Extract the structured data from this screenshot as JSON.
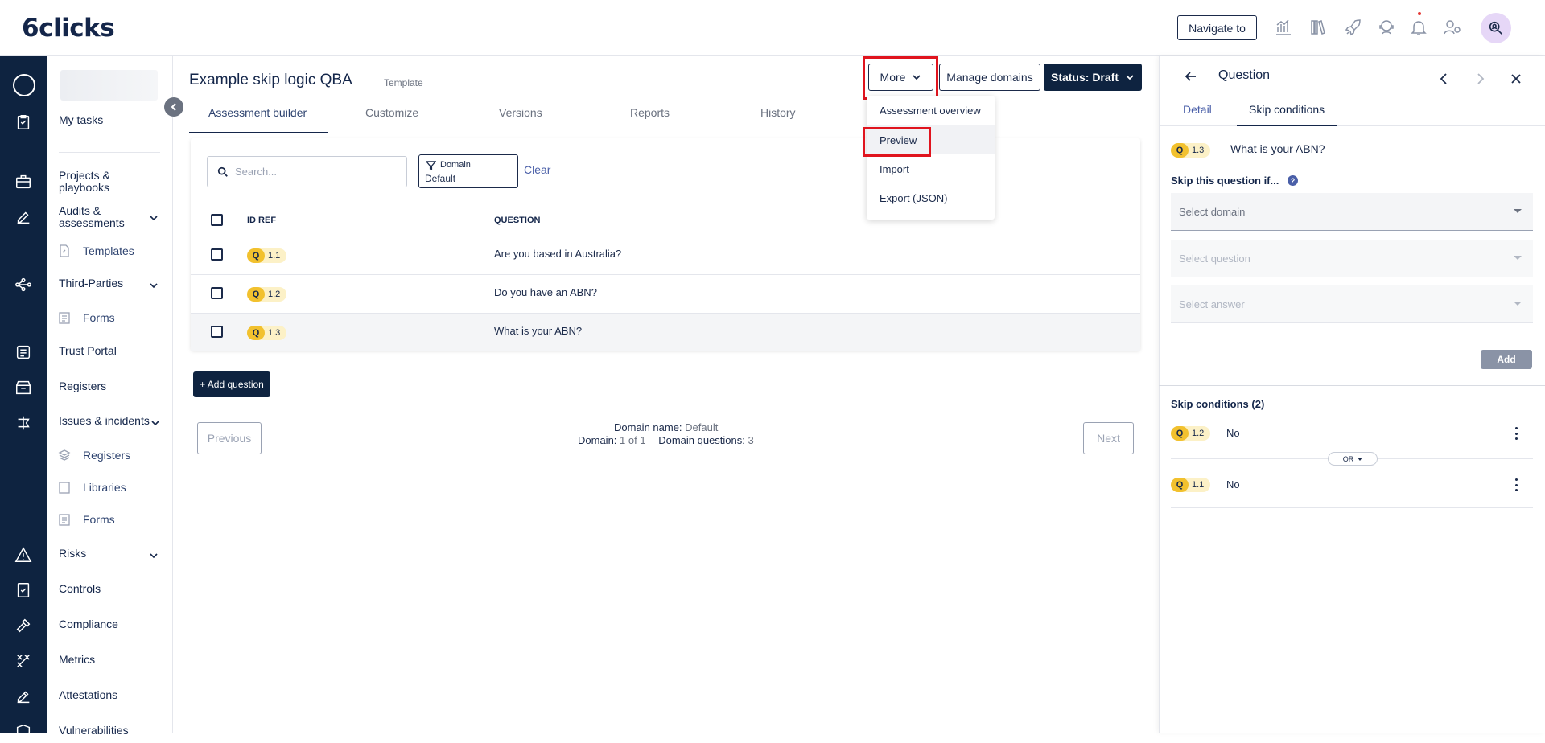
{
  "header": {
    "logo": "6clicks",
    "navigate_to": "Navigate to",
    "icons": [
      "analytics-icon",
      "library-icon",
      "rocket-icon",
      "support-icon",
      "bell-icon",
      "user-settings-icon"
    ],
    "avatar_icon": "search-user-icon"
  },
  "rail": {
    "icons": [
      "tasks-icon",
      "briefcase-icon",
      "edit-icon",
      "network-icon",
      "forms-icon",
      "registers-icon",
      "incident-icon",
      "risk-warning-icon",
      "controls-icon",
      "compliance-gavel-icon",
      "metrics-tools-icon",
      "attestations-icon",
      "vulnerabilities-shield-icon"
    ]
  },
  "sidenav": {
    "my_tasks": "My tasks",
    "projects": "Projects & playbooks",
    "audits": "Audits & assessments",
    "templates": "Templates",
    "third_parties": "Third-Parties",
    "forms1": "Forms",
    "trust_portal": "Trust Portal",
    "registers": "Registers",
    "issues": "Issues & incidents",
    "registers_sub": "Registers",
    "libraries": "Libraries",
    "forms2": "Forms",
    "risks": "Risks",
    "controls": "Controls",
    "compliance": "Compliance",
    "metrics": "Metrics",
    "attestations": "Attestations",
    "vulnerabilities": "Vulnerabilities"
  },
  "main": {
    "title": "Example skip logic QBA",
    "tag": "Template",
    "more": "More",
    "manage_domains": "Manage domains",
    "status": "Status: Draft",
    "tabs": [
      "Assessment builder",
      "Customize",
      "Versions",
      "Reports",
      "History"
    ],
    "dropdown": [
      "Assessment overview",
      "Preview",
      "Import",
      "Export (JSON)"
    ],
    "search_placeholder": "Search...",
    "filter_label": "Domain",
    "filter_value": "Default",
    "clear": "Clear",
    "col_id": "ID REF",
    "col_question": "QUESTION",
    "rows": [
      {
        "badge": "Q",
        "ref": "1.1",
        "question": "Are you based in Australia?"
      },
      {
        "badge": "Q",
        "ref": "1.2",
        "question": "Do you have an ABN?"
      },
      {
        "badge": "Q",
        "ref": "1.3",
        "question": "What is your ABN?"
      }
    ],
    "add_question": "+ Add question",
    "previous": "Previous",
    "next": "Next",
    "domain_name_label": "Domain name:",
    "domain_name_value": "Default",
    "domain_label": "Domain:",
    "domain_value": "1 of 1",
    "domain_questions_label": "Domain questions:",
    "domain_questions_value": "3"
  },
  "panel": {
    "title": "Question",
    "tabs": [
      "Detail",
      "Skip conditions"
    ],
    "q_badge": "Q",
    "q_ref": "1.3",
    "q_text": "What is your ABN?",
    "skip_label": "Skip this question if...",
    "help": "?",
    "select_domain": "Select domain",
    "select_question": "Select question",
    "select_answer": "Select answer",
    "add": "Add",
    "conditions_title": "Skip conditions (2)",
    "conditions": [
      {
        "badge": "Q",
        "ref": "1.2",
        "answer": "No"
      },
      {
        "badge": "Q",
        "ref": "1.1",
        "answer": "No"
      }
    ],
    "or": "OR"
  },
  "colors": {
    "brand": "#0e2340",
    "accent": "#f2c12e",
    "highlight": "#e0141e"
  }
}
